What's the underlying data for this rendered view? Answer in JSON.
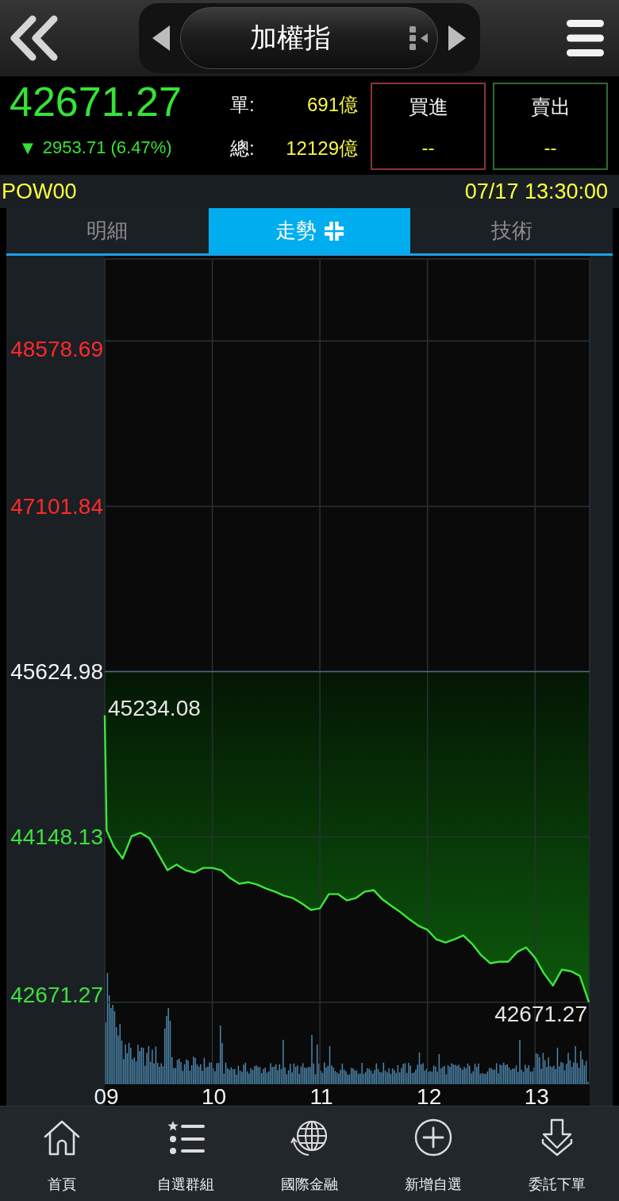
{
  "top_bar": {
    "title": "加權指"
  },
  "quote": {
    "price": "42671.27",
    "arrow": "▼",
    "change": "2953.71 (6.47%)",
    "stats": [
      {
        "label": "單:",
        "value": "691億"
      },
      {
        "label": "總:",
        "value": "12129億"
      }
    ],
    "orders": [
      {
        "kind": "buy",
        "label": "買進",
        "value": "--"
      },
      {
        "kind": "sell",
        "label": "賣出",
        "value": "--"
      }
    ]
  },
  "status_bar": {
    "symbol": "POW00",
    "time": "07/17 13:30:00"
  },
  "tabs": [
    {
      "label": "明細",
      "selected": false
    },
    {
      "label": "走勢",
      "selected": true
    },
    {
      "label": "技術",
      "selected": false
    }
  ],
  "chart": {
    "chart_data": {
      "type": "line",
      "x": [
        9,
        9.0167,
        9.0833,
        9.1667,
        9.25,
        9.3333,
        9.4167,
        9.5,
        9.5833,
        9.6667,
        9.75,
        9.8333,
        9.9167,
        10,
        10.0833,
        10.1667,
        10.25,
        10.3333,
        10.4167,
        10.5,
        10.5833,
        10.6667,
        10.75,
        10.8333,
        10.9167,
        11,
        11.0833,
        11.1667,
        11.25,
        11.3333,
        11.4167,
        11.5,
        11.5833,
        11.6667,
        11.75,
        11.8333,
        11.9167,
        12,
        12.0833,
        12.1667,
        12.25,
        12.3333,
        12.4167,
        12.5,
        12.5833,
        12.6667,
        12.75,
        12.8333,
        12.9167,
        13,
        13.0833,
        13.1667,
        13.25,
        13.3333,
        13.4167,
        13.5
      ],
      "series": [
        {
          "color": "#3ee63e",
          "values": [
            45234.08,
            44205,
            44063,
            43956,
            44155,
            44184,
            44134,
            43992,
            43850,
            43900,
            43850,
            43829,
            43871,
            43871,
            43850,
            43779,
            43729,
            43743,
            43722,
            43687,
            43658,
            43623,
            43601,
            43552,
            43495,
            43509,
            43637,
            43637,
            43580,
            43601,
            43658,
            43672,
            43587,
            43530,
            43474,
            43410,
            43353,
            43317,
            43232,
            43204,
            43232,
            43268,
            43190,
            43090,
            43019,
            43033,
            43033,
            43119,
            43161,
            43069,
            42927,
            42820,
            42962,
            42948,
            42906,
            42671.27
          ]
        }
      ],
      "xlim": [
        9,
        13.5
      ],
      "ylim": [
        41937.88,
        49312.08
      ],
      "xticks": [
        {
          "value": 9,
          "label": "09"
        },
        {
          "value": 10,
          "label": "10"
        },
        {
          "value": 11,
          "label": "11"
        },
        {
          "value": 12,
          "label": "12"
        },
        {
          "value": 13,
          "label": "13"
        }
      ],
      "yticks": [
        {
          "value": 48578.69,
          "label": "48578.69"
        },
        {
          "value": 47101.84,
          "label": "47101.84"
        },
        {
          "value": 45624.98,
          "label": "45624.98"
        },
        {
          "value": 44148.13,
          "label": "44148.13"
        },
        {
          "value": 42671.27,
          "label": "42671.27"
        }
      ],
      "grid": true,
      "ref_lines": [
        {
          "axis": "y",
          "value": 45624.98
        }
      ],
      "annotations": [
        {
          "x": 9,
          "y": 45234.08,
          "text": "45234.08"
        },
        {
          "x": 13.5,
          "y": 42671.27,
          "text": "42671.27"
        }
      ]
    }
  },
  "bottom_nav": [
    {
      "label": "首頁"
    },
    {
      "label": "自選群組"
    },
    {
      "label": "國際金融"
    },
    {
      "label": "新增自選"
    },
    {
      "label": "委託下單"
    }
  ]
}
